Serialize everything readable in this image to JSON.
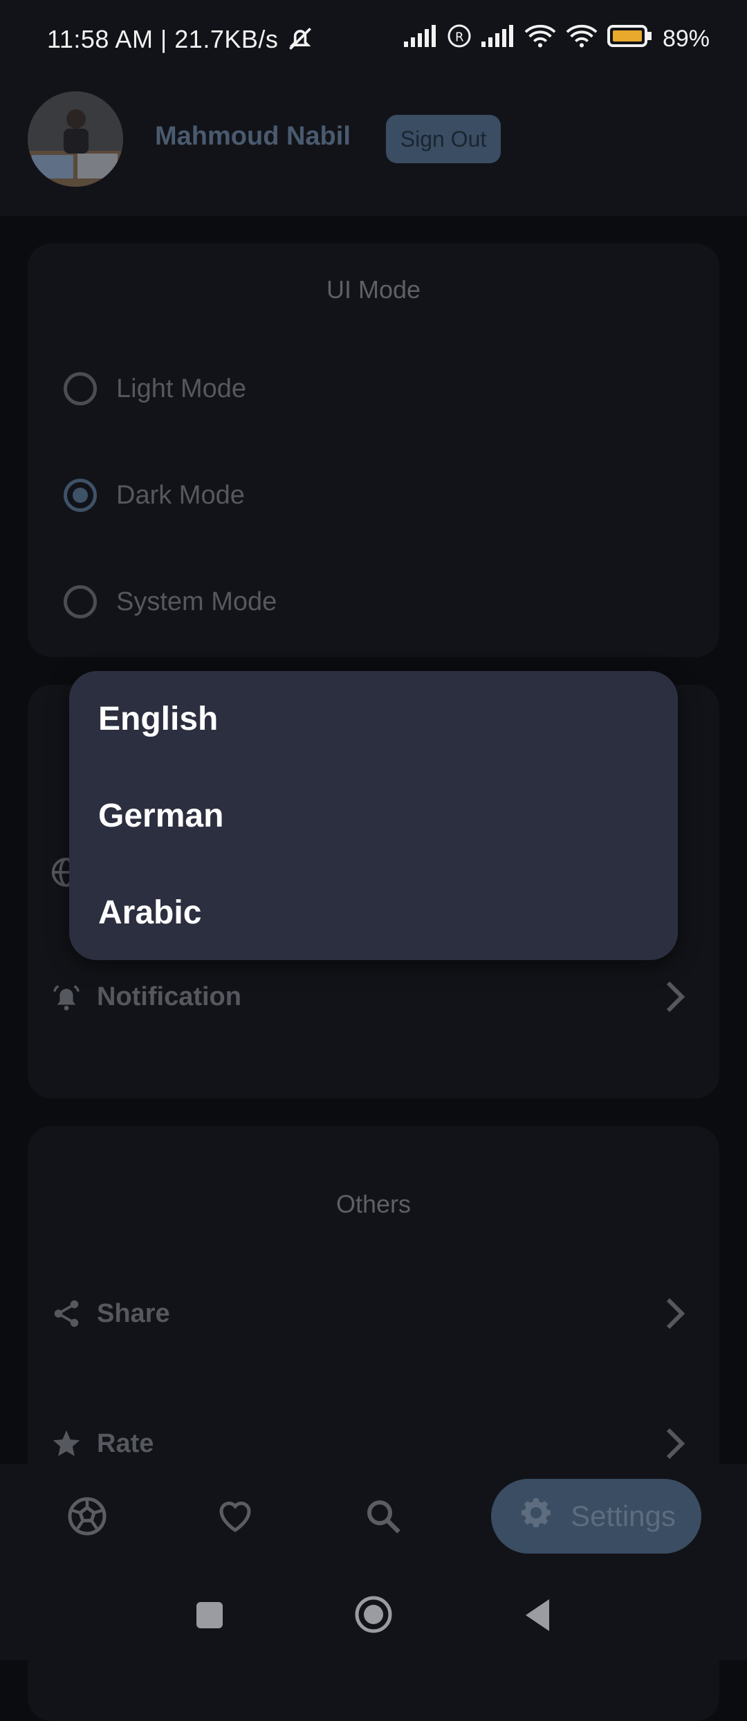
{
  "status_bar": {
    "time": "11:58 AM | 21.7KB/s",
    "battery": "89%"
  },
  "header": {
    "username": "Mahmoud Nabil",
    "sign_out_label": "Sign Out"
  },
  "ui_mode": {
    "title": "UI Mode",
    "options": [
      {
        "label": "Light Mode",
        "selected": false
      },
      {
        "label": "Dark Mode",
        "selected": true
      },
      {
        "label": "System Mode",
        "selected": false
      }
    ]
  },
  "settings_card": {
    "notification_label": "Notification"
  },
  "language_dropdown": {
    "options": [
      "English",
      "German",
      "Arabic"
    ]
  },
  "others": {
    "title": "Others",
    "items": [
      {
        "label": "Share",
        "icon": "share-icon"
      },
      {
        "label": "Rate",
        "icon": "star-icon"
      }
    ]
  },
  "bottom_nav": {
    "settings_label": "Settings",
    "items": [
      "soccer-ball-icon",
      "heart-icon",
      "search-icon",
      "gear-icon"
    ]
  },
  "colors": {
    "background": "#0b0c0f",
    "card": "#121318",
    "accent": "#3a4d62",
    "dropdown": "#2c2f3f"
  }
}
